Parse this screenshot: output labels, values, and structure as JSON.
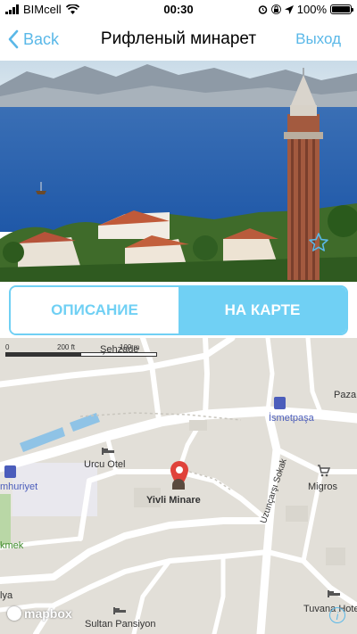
{
  "status_bar": {
    "carrier": "BIMcell",
    "time": "00:30",
    "battery_percent": "100%",
    "battery_level": 1.0,
    "icons": [
      "signal-bars-icon",
      "wifi-icon",
      "alarm-icon",
      "lock-rotation-icon",
      "location-arrow-icon",
      "battery-icon"
    ]
  },
  "nav": {
    "back_label": "Back",
    "title": "Рифленый минарет",
    "exit_label": "Выход"
  },
  "hero": {
    "favorite_icon": "star-icon"
  },
  "segment": {
    "description_label": "ОПИСАНИЕ",
    "map_label": "НА КАРТЕ",
    "selected": "map"
  },
  "map": {
    "scale": {
      "zero": "0",
      "ft": "200 ft",
      "m": "100 m"
    },
    "labels": {
      "sehzade": "Şehzade",
      "ismetpasa": "İsmetpaşa",
      "paza": "Paza",
      "cumhuriyet": "mhuriyet",
      "urcu_otel": "Urcu Otel",
      "yivli_minare": "Yivli Minare",
      "migros": "Migros",
      "uzuncarsi": "Uzunçarşı Sokak",
      "ekmek": "kmek",
      "sultan_pansiyon": "Sultan Pansiyon",
      "tuvana": "Tuvana Hote",
      "lya": "lya"
    },
    "attribution": "mapbox",
    "info": "i"
  },
  "colors": {
    "accent": "#5ab8e8",
    "segment_active": "#70d0f4",
    "pin": "#e0423a",
    "map_bg": "#e2dfd8",
    "road": "#ffffff"
  }
}
